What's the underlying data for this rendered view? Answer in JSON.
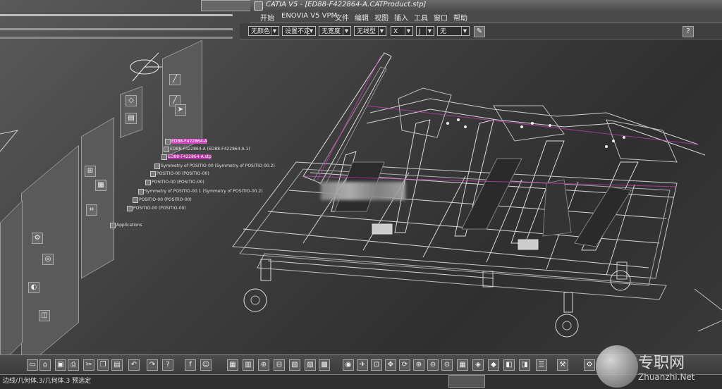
{
  "window": {
    "title": "CATIA V5 - [ED88-F422864-A.CATProduct.stp]"
  },
  "menu": {
    "items": [
      "开始",
      "ENOVIA V5 VPM",
      "文件",
      "编辑",
      "视图",
      "插入",
      "工具",
      "窗口",
      "帮助"
    ]
  },
  "toolbar": {
    "combos": [
      {
        "value": "无颜色"
      },
      {
        "value": "设置不定"
      },
      {
        "value": "无宽度"
      },
      {
        "value": "无线型"
      },
      {
        "value": "X"
      },
      {
        "value": "J"
      },
      {
        "value": "无"
      }
    ]
  },
  "tree": {
    "items": [
      "ED88-F422864-A",
      "ED88-F422864-A (ED88-F422864-A.1)",
      "ED88-F422864-A.stp",
      "Symmetry of POSITIO-00 (Symmetry of POSITIO-00.2)",
      "POSITIO-00 (POSITIO-00)",
      "POSITIO-00 (POSITIO-00)",
      "Symmetry of POSITIO-00.1 (Symmetry of POSITIO-00.2)",
      "POSITIO-00 (POSITIO-00)",
      "POSITIO-00 (POSITIO-00)",
      "Applications"
    ]
  },
  "status": {
    "text": "边线/几何体.3/几何体.3 预选定"
  },
  "watermark": {
    "brand": "专职网",
    "url": "Zhuanzhi.Net"
  },
  "colors": {
    "background": "#3c3c3c",
    "panel": "#5a5a5a",
    "accent_magenta": "#d040c0"
  }
}
